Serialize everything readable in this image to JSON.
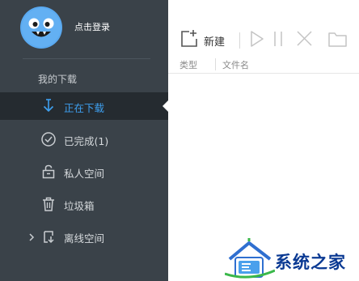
{
  "user": {
    "login_text": "点击登录",
    "avatar_icon": "smiley-avatar-icon"
  },
  "sidebar": {
    "section_title": "我的下载",
    "items": [
      {
        "label": "正在下载",
        "icon": "download-arrow-icon",
        "active": true
      },
      {
        "label": "已完成(1)",
        "icon": "check-circle-icon",
        "active": false
      },
      {
        "label": "私人空间",
        "icon": "lock-icon",
        "active": false
      },
      {
        "label": "垃圾箱",
        "icon": "trash-icon",
        "active": false
      },
      {
        "label": "离线空间",
        "icon": "cloud-download-icon",
        "active": false,
        "expandable": true
      }
    ]
  },
  "toolbar": {
    "new_label": "新建",
    "buttons": [
      "new-task-icon",
      "play-icon",
      "pause-icon",
      "delete-icon",
      "folder-icon"
    ]
  },
  "columns": {
    "type": "类型",
    "name": "文件名"
  },
  "watermark": {
    "text": "系统之家"
  },
  "colors": {
    "sidebar_bg": "#3a4249",
    "active_item_bg": "#252b30",
    "accent": "#3ea0f0",
    "avatar_bg": "#5aa9f0",
    "watermark_text": "#0b3a93"
  }
}
